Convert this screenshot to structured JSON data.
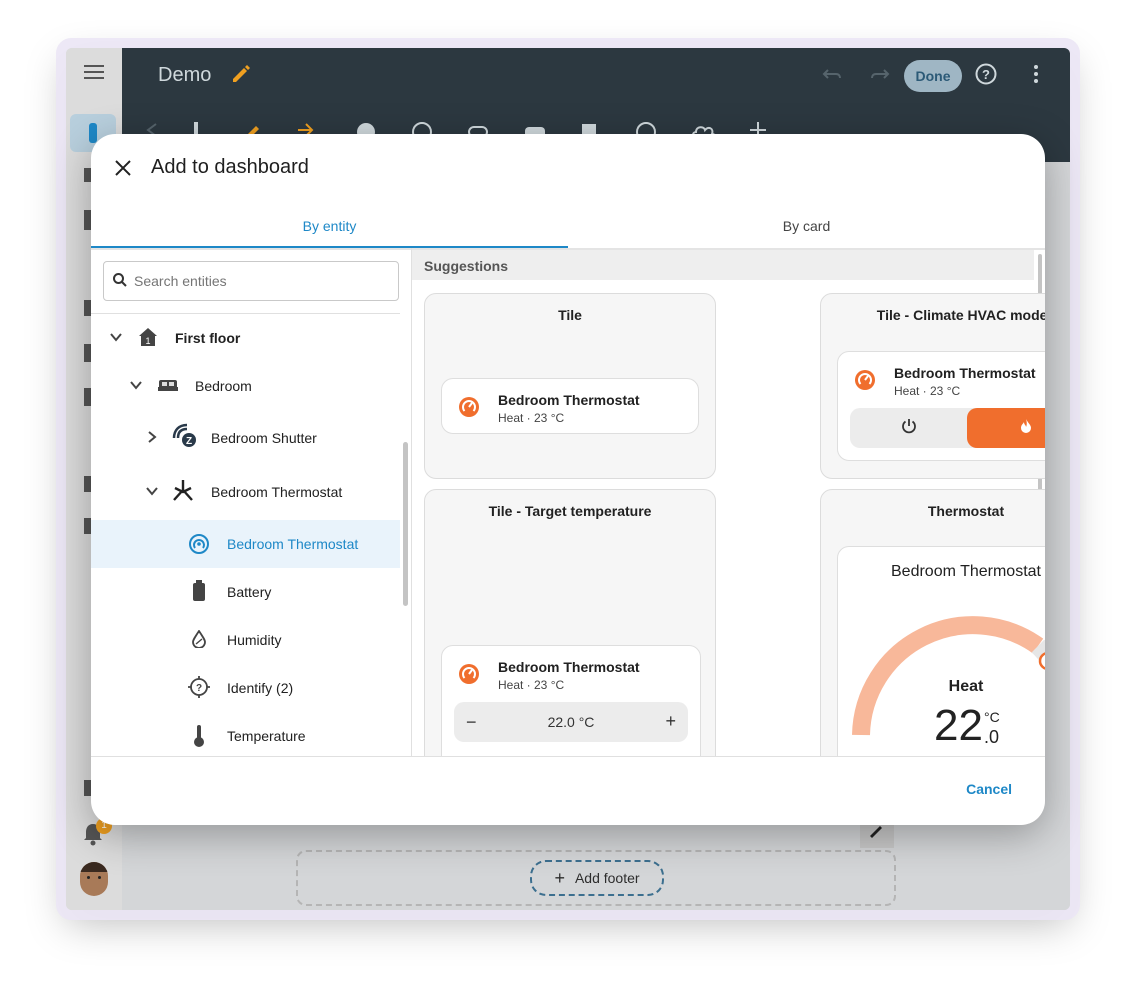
{
  "app": {
    "dashboard_title": "Demo",
    "done_label": "Done",
    "add_footer_label": "Add footer",
    "notification_count": "1"
  },
  "dialog": {
    "title": "Add to dashboard",
    "tabs": [
      {
        "label": "By entity",
        "active": true
      },
      {
        "label": "By card",
        "active": false
      }
    ],
    "search_placeholder": "Search entities",
    "cancel_label": "Cancel"
  },
  "tree": {
    "floor": "First floor",
    "area": "Bedroom",
    "devices": [
      {
        "label": "Bedroom Shutter",
        "expanded": false,
        "icon": "zwave-icon"
      },
      {
        "label": "Bedroom Thermostat",
        "expanded": true,
        "icon": "zigbee-icon"
      }
    ],
    "entities": [
      {
        "label": "Bedroom Thermostat",
        "icon": "thermostat-icon",
        "selected": true
      },
      {
        "label": "Battery",
        "icon": "battery-icon",
        "selected": false
      },
      {
        "label": "Humidity",
        "icon": "humidity-icon",
        "selected": false
      },
      {
        "label": "Identify (2)",
        "icon": "identify-icon",
        "selected": false
      },
      {
        "label": "Temperature",
        "icon": "thermometer-icon",
        "selected": false
      }
    ]
  },
  "suggestions": {
    "heading": "Suggestions",
    "cards": [
      {
        "title": "Tile"
      },
      {
        "title": "Tile - Climate HVAC modes"
      },
      {
        "title": "Tile - Target temperature"
      },
      {
        "title": "Thermostat"
      }
    ],
    "entity_name": "Bedroom Thermostat",
    "entity_state": "Heat · 23 °C",
    "target_temp": "22.0 °C",
    "minus": "−",
    "plus": "+",
    "thermostat": {
      "mode": "Heat",
      "value_int": "22",
      "unit": "°C",
      "value_dec": ".0"
    }
  },
  "colors": {
    "accent": "#1e88c7",
    "heat": "#f06e2d",
    "heat_light": "#f8b89a",
    "topbar": "#2c3840"
  }
}
